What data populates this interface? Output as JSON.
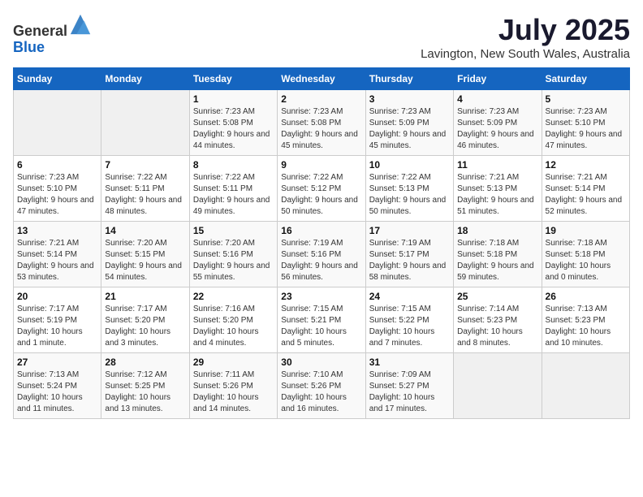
{
  "header": {
    "logo_line1": "General",
    "logo_line2": "Blue",
    "month_year": "July 2025",
    "location": "Lavington, New South Wales, Australia"
  },
  "days_of_week": [
    "Sunday",
    "Monday",
    "Tuesday",
    "Wednesday",
    "Thursday",
    "Friday",
    "Saturday"
  ],
  "weeks": [
    [
      {
        "day": "",
        "empty": true
      },
      {
        "day": "",
        "empty": true
      },
      {
        "day": "1",
        "sunrise": "7:23 AM",
        "sunset": "5:08 PM",
        "daylight": "9 hours and 44 minutes."
      },
      {
        "day": "2",
        "sunrise": "7:23 AM",
        "sunset": "5:08 PM",
        "daylight": "9 hours and 45 minutes."
      },
      {
        "day": "3",
        "sunrise": "7:23 AM",
        "sunset": "5:09 PM",
        "daylight": "9 hours and 45 minutes."
      },
      {
        "day": "4",
        "sunrise": "7:23 AM",
        "sunset": "5:09 PM",
        "daylight": "9 hours and 46 minutes."
      },
      {
        "day": "5",
        "sunrise": "7:23 AM",
        "sunset": "5:10 PM",
        "daylight": "9 hours and 47 minutes."
      }
    ],
    [
      {
        "day": "6",
        "sunrise": "7:23 AM",
        "sunset": "5:10 PM",
        "daylight": "9 hours and 47 minutes."
      },
      {
        "day": "7",
        "sunrise": "7:22 AM",
        "sunset": "5:11 PM",
        "daylight": "9 hours and 48 minutes."
      },
      {
        "day": "8",
        "sunrise": "7:22 AM",
        "sunset": "5:11 PM",
        "daylight": "9 hours and 49 minutes."
      },
      {
        "day": "9",
        "sunrise": "7:22 AM",
        "sunset": "5:12 PM",
        "daylight": "9 hours and 50 minutes."
      },
      {
        "day": "10",
        "sunrise": "7:22 AM",
        "sunset": "5:13 PM",
        "daylight": "9 hours and 50 minutes."
      },
      {
        "day": "11",
        "sunrise": "7:21 AM",
        "sunset": "5:13 PM",
        "daylight": "9 hours and 51 minutes."
      },
      {
        "day": "12",
        "sunrise": "7:21 AM",
        "sunset": "5:14 PM",
        "daylight": "9 hours and 52 minutes."
      }
    ],
    [
      {
        "day": "13",
        "sunrise": "7:21 AM",
        "sunset": "5:14 PM",
        "daylight": "9 hours and 53 minutes."
      },
      {
        "day": "14",
        "sunrise": "7:20 AM",
        "sunset": "5:15 PM",
        "daylight": "9 hours and 54 minutes."
      },
      {
        "day": "15",
        "sunrise": "7:20 AM",
        "sunset": "5:16 PM",
        "daylight": "9 hours and 55 minutes."
      },
      {
        "day": "16",
        "sunrise": "7:19 AM",
        "sunset": "5:16 PM",
        "daylight": "9 hours and 56 minutes."
      },
      {
        "day": "17",
        "sunrise": "7:19 AM",
        "sunset": "5:17 PM",
        "daylight": "9 hours and 58 minutes."
      },
      {
        "day": "18",
        "sunrise": "7:18 AM",
        "sunset": "5:18 PM",
        "daylight": "9 hours and 59 minutes."
      },
      {
        "day": "19",
        "sunrise": "7:18 AM",
        "sunset": "5:18 PM",
        "daylight": "10 hours and 0 minutes."
      }
    ],
    [
      {
        "day": "20",
        "sunrise": "7:17 AM",
        "sunset": "5:19 PM",
        "daylight": "10 hours and 1 minute."
      },
      {
        "day": "21",
        "sunrise": "7:17 AM",
        "sunset": "5:20 PM",
        "daylight": "10 hours and 3 minutes."
      },
      {
        "day": "22",
        "sunrise": "7:16 AM",
        "sunset": "5:20 PM",
        "daylight": "10 hours and 4 minutes."
      },
      {
        "day": "23",
        "sunrise": "7:15 AM",
        "sunset": "5:21 PM",
        "daylight": "10 hours and 5 minutes."
      },
      {
        "day": "24",
        "sunrise": "7:15 AM",
        "sunset": "5:22 PM",
        "daylight": "10 hours and 7 minutes."
      },
      {
        "day": "25",
        "sunrise": "7:14 AM",
        "sunset": "5:23 PM",
        "daylight": "10 hours and 8 minutes."
      },
      {
        "day": "26",
        "sunrise": "7:13 AM",
        "sunset": "5:23 PM",
        "daylight": "10 hours and 10 minutes."
      }
    ],
    [
      {
        "day": "27",
        "sunrise": "7:13 AM",
        "sunset": "5:24 PM",
        "daylight": "10 hours and 11 minutes."
      },
      {
        "day": "28",
        "sunrise": "7:12 AM",
        "sunset": "5:25 PM",
        "daylight": "10 hours and 13 minutes."
      },
      {
        "day": "29",
        "sunrise": "7:11 AM",
        "sunset": "5:26 PM",
        "daylight": "10 hours and 14 minutes."
      },
      {
        "day": "30",
        "sunrise": "7:10 AM",
        "sunset": "5:26 PM",
        "daylight": "10 hours and 16 minutes."
      },
      {
        "day": "31",
        "sunrise": "7:09 AM",
        "sunset": "5:27 PM",
        "daylight": "10 hours and 17 minutes."
      },
      {
        "day": "",
        "empty": true
      },
      {
        "day": "",
        "empty": true
      }
    ]
  ]
}
